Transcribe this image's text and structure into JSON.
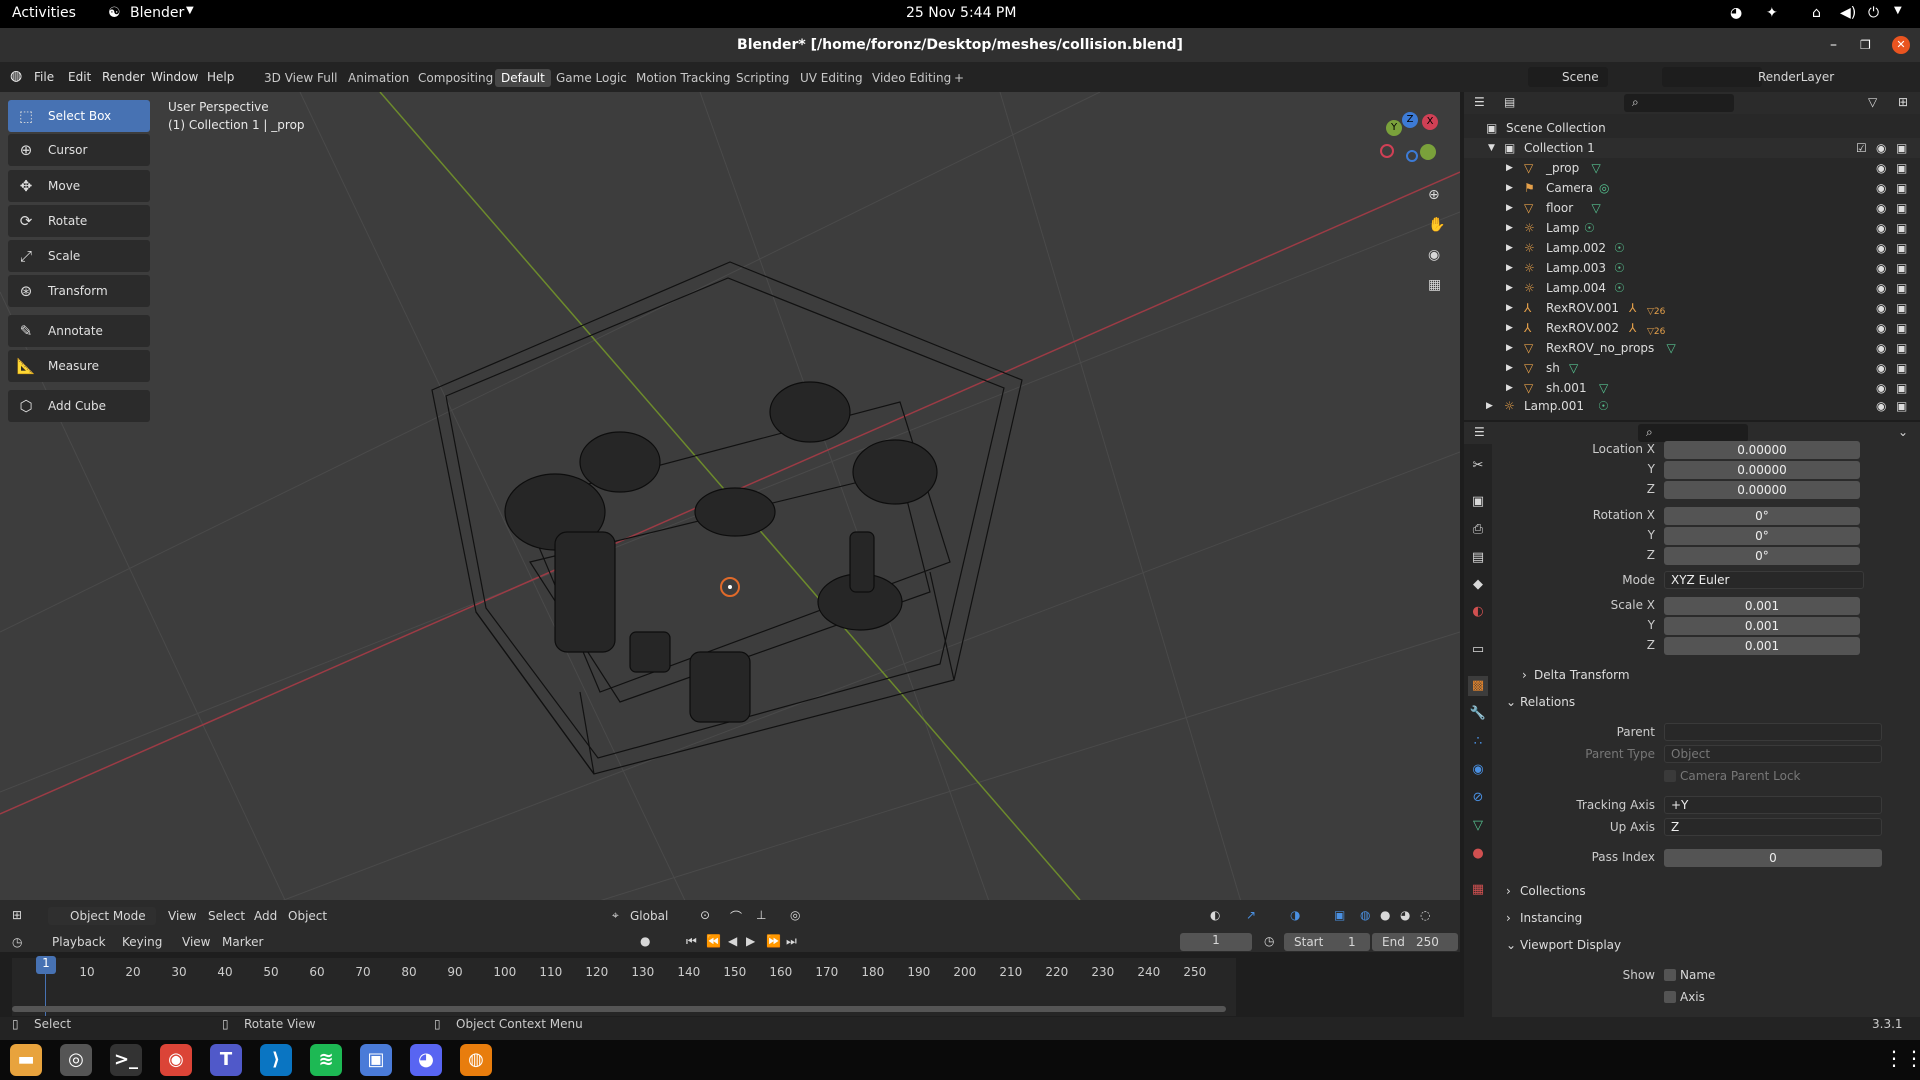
{
  "topbar": {
    "activities": "Activities",
    "app": "Blender",
    "datetime": "25 Nov  5:44 PM"
  },
  "window": {
    "title": "Blender* [/home/foronz/Desktop/meshes/collision.blend]"
  },
  "menu": [
    "File",
    "Edit",
    "Render",
    "Window",
    "Help"
  ],
  "workspaces": [
    "3D View Full",
    "Animation",
    "Compositing",
    "Default",
    "Game Logic",
    "Motion Tracking",
    "Scripting",
    "UV Editing",
    "Video Editing",
    "+"
  ],
  "active_workspace": "Default",
  "scene": {
    "scene_label": "Scene",
    "renderlayer_label": "RenderLayer"
  },
  "viewport": {
    "perspective": "User Perspective",
    "collection_info": "(1) Collection 1 | _prop",
    "gizmo": {
      "x": "X",
      "y": "Y",
      "z": "Z"
    },
    "header": {
      "mode": "Object Mode",
      "menus": [
        "View",
        "Select",
        "Add",
        "Object"
      ],
      "orientation": "Global"
    }
  },
  "tools": [
    "Select Box",
    "Cursor",
    "Move",
    "Rotate",
    "Scale",
    "Transform",
    "Annotate",
    "Measure",
    "Add Cube"
  ],
  "outliner": {
    "root": "Scene Collection",
    "collection": "Collection 1",
    "items": [
      {
        "name": "_prop",
        "badge": ""
      },
      {
        "name": "Camera",
        "badge": ""
      },
      {
        "name": "floor",
        "badge": ""
      },
      {
        "name": "Lamp",
        "badge": ""
      },
      {
        "name": "Lamp.002",
        "badge": ""
      },
      {
        "name": "Lamp.003",
        "badge": ""
      },
      {
        "name": "Lamp.004",
        "badge": ""
      },
      {
        "name": "RexROV.001",
        "badge": "26"
      },
      {
        "name": "RexROV.002",
        "badge": "26"
      },
      {
        "name": "RexROV_no_props",
        "badge": ""
      },
      {
        "name": "sh",
        "badge": ""
      },
      {
        "name": "sh.001",
        "badge": ""
      }
    ],
    "extra": "Lamp.001"
  },
  "properties": {
    "location": {
      "label": "Location X",
      "x": "0.00000",
      "y": "0.00000",
      "z": "0.00000"
    },
    "rotation": {
      "label": "Rotation X",
      "x": "0°",
      "y": "0°",
      "z": "0°"
    },
    "mode_label": "Mode",
    "mode": "XYZ Euler",
    "scale": {
      "label": "Scale X",
      "x": "0.001",
      "y": "0.001",
      "z": "0.001"
    },
    "axis_y": "Y",
    "axis_z": "Z",
    "delta": "Delta Transform",
    "relations": "Relations",
    "parent_label": "Parent",
    "parent_type_label": "Parent Type",
    "parent_type": "Object",
    "camera_parent_lock": "Camera Parent Lock",
    "tracking_label": "Tracking Axis",
    "tracking": "+Y",
    "up_label": "Up Axis",
    "up": "Z",
    "pass_label": "Pass Index",
    "pass": "0",
    "collections": "Collections",
    "instancing": "Instancing",
    "viewport_display": "Viewport Display",
    "show_label": "Show",
    "show_name": "Name",
    "show_axis": "Axis"
  },
  "timeline": {
    "menus": [
      "Playback",
      "Keying",
      "View",
      "Marker"
    ],
    "current": "1",
    "start_label": "Start",
    "start": "1",
    "end_label": "End",
    "end": "250",
    "ticks": [
      "1",
      "10",
      "20",
      "30",
      "40",
      "50",
      "60",
      "70",
      "80",
      "90",
      "100",
      "110",
      "120",
      "130",
      "140",
      "150",
      "160",
      "170",
      "180",
      "190",
      "200",
      "210",
      "220",
      "230",
      "240",
      "250"
    ]
  },
  "status": {
    "select": "Select",
    "rotate": "Rotate View",
    "context": "Object Context Menu",
    "version": "3.3.1"
  },
  "dock": [
    {
      "name": "files",
      "color": "#e8a33d",
      "glyph": "▬"
    },
    {
      "name": "settings",
      "color": "#555",
      "glyph": "◎"
    },
    {
      "name": "terminal",
      "color": "#333",
      "glyph": ">_"
    },
    {
      "name": "chrome",
      "color": "#db4437",
      "glyph": "◉"
    },
    {
      "name": "teams",
      "color": "#5059c9",
      "glyph": "T"
    },
    {
      "name": "vscode",
      "color": "#0a75c2",
      "glyph": "⟩"
    },
    {
      "name": "spotify",
      "color": "#1db954",
      "glyph": "≋"
    },
    {
      "name": "app",
      "color": "#4a7bd8",
      "glyph": "▣"
    },
    {
      "name": "discord",
      "color": "#5865f2",
      "glyph": "◕"
    },
    {
      "name": "blender",
      "color": "#e87d0d",
      "glyph": "◍"
    }
  ]
}
